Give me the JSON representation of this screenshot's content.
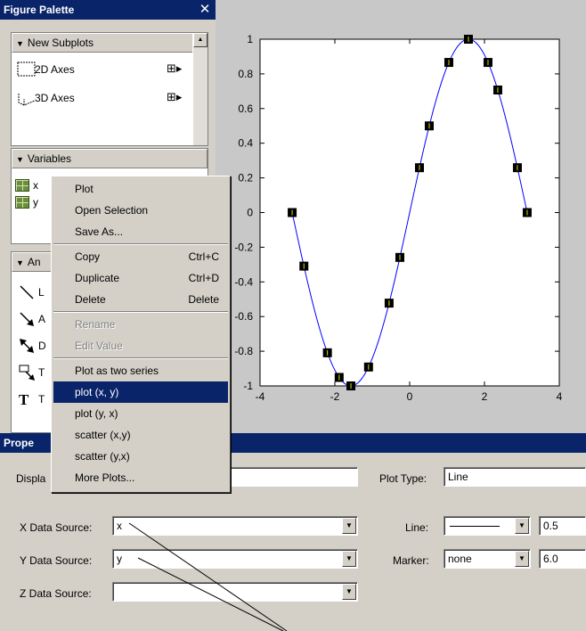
{
  "palette": {
    "title": "Figure Palette",
    "close_icon": "close-icon",
    "new_subplots_header": "New Subplots",
    "items": [
      {
        "label": "2D Axes",
        "icon": "2d-axes-icon"
      },
      {
        "label": "3D Axes",
        "icon": "3d-axes-icon"
      }
    ],
    "variables_header": "Variables",
    "variables": [
      "x",
      "y"
    ],
    "annotations_header": "An",
    "annotation_items": [
      {
        "label": "L",
        "icon": "line-icon"
      },
      {
        "label": "A",
        "icon": "arrow-icon"
      },
      {
        "label": "D",
        "icon": "double-arrow-icon"
      },
      {
        "label": "T",
        "icon": "text-arrow-icon"
      },
      {
        "label": "T",
        "icon": "text-box-icon"
      }
    ]
  },
  "context_menu": {
    "items": [
      {
        "label": "Plot",
        "shortcut": "",
        "state": "normal"
      },
      {
        "label": "Open Selection",
        "shortcut": "",
        "state": "normal"
      },
      {
        "label": "Save As...",
        "shortcut": "",
        "state": "normal"
      },
      {
        "label": "Copy",
        "shortcut": "Ctrl+C",
        "state": "normal"
      },
      {
        "label": "Duplicate",
        "shortcut": "Ctrl+D",
        "state": "normal"
      },
      {
        "label": "Delete",
        "shortcut": "Delete",
        "state": "normal"
      },
      {
        "label": "Rename",
        "shortcut": "",
        "state": "disabled"
      },
      {
        "label": "Edit Value",
        "shortcut": "",
        "state": "disabled"
      },
      {
        "label": "Plot as two series",
        "shortcut": "",
        "state": "normal"
      },
      {
        "label": "plot (x, y)",
        "shortcut": "",
        "state": "selected"
      },
      {
        "label": "plot (y, x)",
        "shortcut": "",
        "state": "normal"
      },
      {
        "label": "scatter (x,y)",
        "shortcut": "",
        "state": "normal"
      },
      {
        "label": "scatter (y,x)",
        "shortcut": "",
        "state": "normal"
      },
      {
        "label": "More Plots...",
        "shortcut": "",
        "state": "normal"
      }
    ]
  },
  "property_editor": {
    "title": "Prope",
    "display_name_label": "Displa",
    "display_name_value": "",
    "plot_type_label": "Plot Type:",
    "plot_type_value": "Line",
    "x_source_label": "X Data Source:",
    "x_source_value": "x",
    "y_source_label": "Y Data Source:",
    "y_source_value": "y",
    "z_source_label": "Z Data Source:",
    "z_source_value": "",
    "line_label": "Line:",
    "line_width": "0.5",
    "marker_label": "Marker:",
    "marker_value": "none",
    "marker_size": "6.0"
  },
  "chart_data": {
    "type": "line",
    "title": "",
    "xlabel": "",
    "ylabel": "",
    "xlim": [
      -4,
      4
    ],
    "ylim": [
      -1,
      1
    ],
    "xticks": [
      "-4",
      "-2",
      "0",
      "2",
      "4"
    ],
    "yticks": [
      "1",
      "0.8",
      "0.6",
      "0.4",
      "0.2",
      "0",
      "-0.2",
      "-0.4",
      "-0.6",
      "-0.8",
      "-1"
    ],
    "curve_color": "#0000ff",
    "marker_color": "#000000",
    "series": [
      {
        "x": [
          -3.1416,
          -2.8274,
          -2.1991,
          -1.885,
          -1.5708,
          -1.0996,
          -0.5498,
          -0.2618,
          0.2618,
          0.5236,
          1.0472,
          1.5708,
          2.0944,
          2.3562,
          2.8798,
          3.1416
        ],
        "y": [
          0,
          -0.309,
          -0.809,
          -0.9511,
          -1.0,
          -0.891,
          -0.5225,
          -0.2588,
          0.2588,
          0.5,
          0.866,
          1.0,
          0.866,
          0.7071,
          0.2588,
          0
        ]
      }
    ]
  }
}
